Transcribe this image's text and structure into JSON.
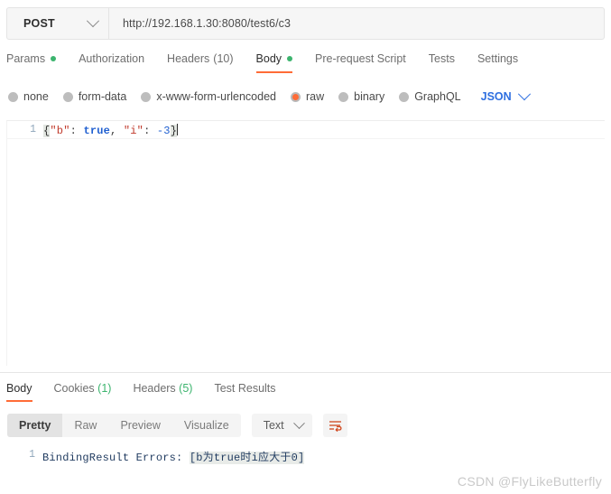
{
  "request_bar": {
    "method": "POST",
    "method_chevron_icon": "chevron-down-icon",
    "url": "http://192.168.1.30:8080/test6/c3",
    "url_placeholder": "Enter request URL"
  },
  "request_tabs": [
    {
      "label": "Params",
      "indicator": "green-dot",
      "active": false
    },
    {
      "label": "Authorization",
      "indicator": "",
      "active": false
    },
    {
      "label": "Headers",
      "count": "(10)",
      "indicator": "",
      "active": false
    },
    {
      "label": "Body",
      "indicator": "green-dot",
      "active": true
    },
    {
      "label": "Pre-request Script",
      "indicator": "",
      "active": false
    },
    {
      "label": "Tests",
      "indicator": "",
      "active": false
    },
    {
      "label": "Settings",
      "indicator": "",
      "active": false
    }
  ],
  "body_types": {
    "options": [
      {
        "label": "none",
        "selected": false
      },
      {
        "label": "form-data",
        "selected": false
      },
      {
        "label": "x-www-form-urlencoded",
        "selected": false
      },
      {
        "label": "raw",
        "selected": true
      },
      {
        "label": "binary",
        "selected": false
      },
      {
        "label": "GraphQL",
        "selected": false
      }
    ],
    "format": "JSON",
    "format_chevron_icon": "chevron-down-icon"
  },
  "request_editor": {
    "line_number": "1",
    "tokens": {
      "open_brace": "{",
      "key_b": "\"b\"",
      "colon_1": ": ",
      "value_true": "true",
      "comma": ", ",
      "key_i": "\"i\"",
      "colon_2": ": ",
      "value_num": "-3",
      "close_brace": "}"
    },
    "raw_text": "{\"b\": true, \"i\": -3}"
  },
  "response_tabs": [
    {
      "label": "Body",
      "count": "",
      "active": true
    },
    {
      "label": "Cookies",
      "count": "(1)",
      "active": false
    },
    {
      "label": "Headers",
      "count": "(5)",
      "active": false
    },
    {
      "label": "Test Results",
      "count": "",
      "active": false
    }
  ],
  "response_toolbar": {
    "segments": [
      {
        "label": "Pretty",
        "active": true
      },
      {
        "label": "Raw",
        "active": false
      },
      {
        "label": "Preview",
        "active": false
      },
      {
        "label": "Visualize",
        "active": false
      }
    ],
    "content_type": "Text",
    "content_type_chevron_icon": "chevron-down-icon",
    "wrap_icon": "word-wrap-icon"
  },
  "response_body": {
    "line_number": "1",
    "prefix": "BindingResult Errors: ",
    "highlighted": "[b为true时i应大于0]",
    "full_text": "BindingResult Errors: [b为true时i应大于0]"
  },
  "watermark": {
    "text": "CSDN @FlyLikeButterfly"
  },
  "colors": {
    "accent_orange": "#ff6c37",
    "dot_green": "#3cb46e",
    "link_blue": "#2e6fe0",
    "string_red": "#c0392b",
    "keyword_blue": "#1f5fd0"
  }
}
